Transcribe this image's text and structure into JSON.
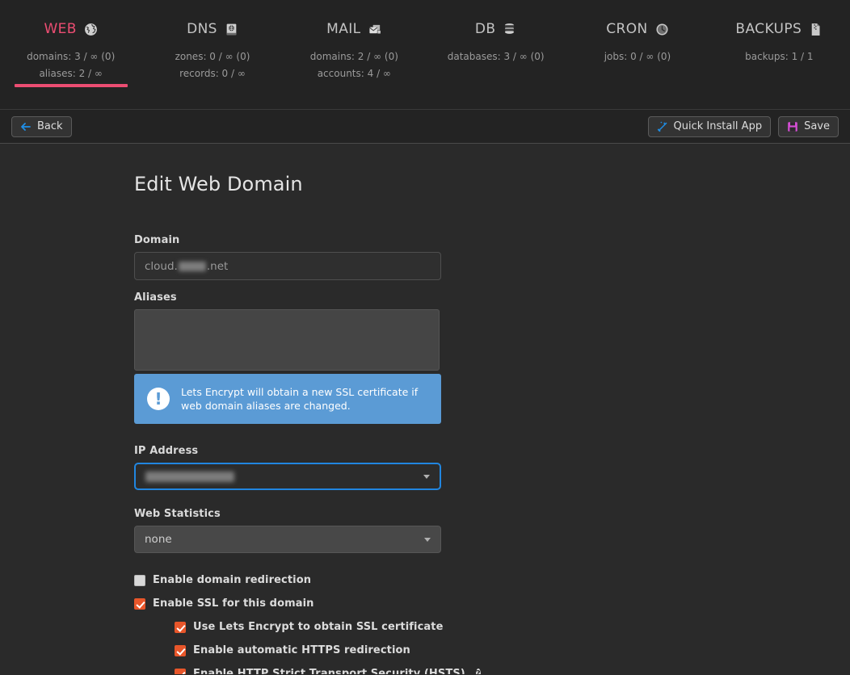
{
  "nav": {
    "tabs": [
      {
        "name": "WEB",
        "icon": "globe-icon",
        "active": true,
        "stats": [
          "domains: 3 / ∞ (0)",
          "aliases: 2 / ∞"
        ]
      },
      {
        "name": "DNS",
        "icon": "dns-book-icon",
        "active": false,
        "stats": [
          "zones: 0 / ∞ (0)",
          "records: 0 / ∞"
        ]
      },
      {
        "name": "MAIL",
        "icon": "mail-envelope-icon",
        "active": false,
        "stats": [
          "domains: 2 / ∞ (0)",
          "accounts: 4 / ∞"
        ]
      },
      {
        "name": "DB",
        "icon": "database-icon",
        "active": false,
        "stats": [
          "databases: 3 / ∞ (0)"
        ]
      },
      {
        "name": "CRON",
        "icon": "clock-icon",
        "active": false,
        "stats": [
          "jobs: 0 / ∞ (0)"
        ]
      },
      {
        "name": "BACKUPS",
        "icon": "archive-file-icon",
        "active": false,
        "stats": [
          "backups: 1 / 1"
        ]
      }
    ],
    "active_accent": "#ec4d72"
  },
  "toolbar": {
    "back_label": "Back",
    "quick_install_label": "Quick Install App",
    "save_label": "Save"
  },
  "page": {
    "title": "Edit Web Domain"
  },
  "form": {
    "domain": {
      "label": "Domain",
      "value_prefix": "cloud.",
      "value_suffix": ".net",
      "redacted": true
    },
    "aliases": {
      "label": "Aliases",
      "value": ""
    },
    "alert": {
      "icon": "exclamation-circle-icon",
      "glyph": "!",
      "text": "Lets Encrypt will obtain a new SSL certificate if web domain aliases are changed.",
      "color": "#5b9bd5"
    },
    "ip_address": {
      "label": "IP Address",
      "value": "",
      "redacted": true,
      "focused": true,
      "focus_color": "#2186e0"
    },
    "web_statistics": {
      "label": "Web Statistics",
      "value": "none"
    },
    "checkboxes": [
      {
        "label": "Enable domain redirection",
        "checked": false,
        "indent": false,
        "help": false
      },
      {
        "label": "Enable SSL for this domain",
        "checked": true,
        "indent": false,
        "help": false
      },
      {
        "label": "Use Lets Encrypt to obtain SSL certificate",
        "checked": true,
        "indent": true,
        "help": false
      },
      {
        "label": "Enable automatic HTTPS redirection",
        "checked": true,
        "indent": true,
        "help": false
      },
      {
        "label": "Enable HTTP Strict Transport Security (HSTS)",
        "checked": true,
        "indent": true,
        "help": true,
        "help_glyph": "?"
      }
    ],
    "checked_color": "#e8562a"
  }
}
